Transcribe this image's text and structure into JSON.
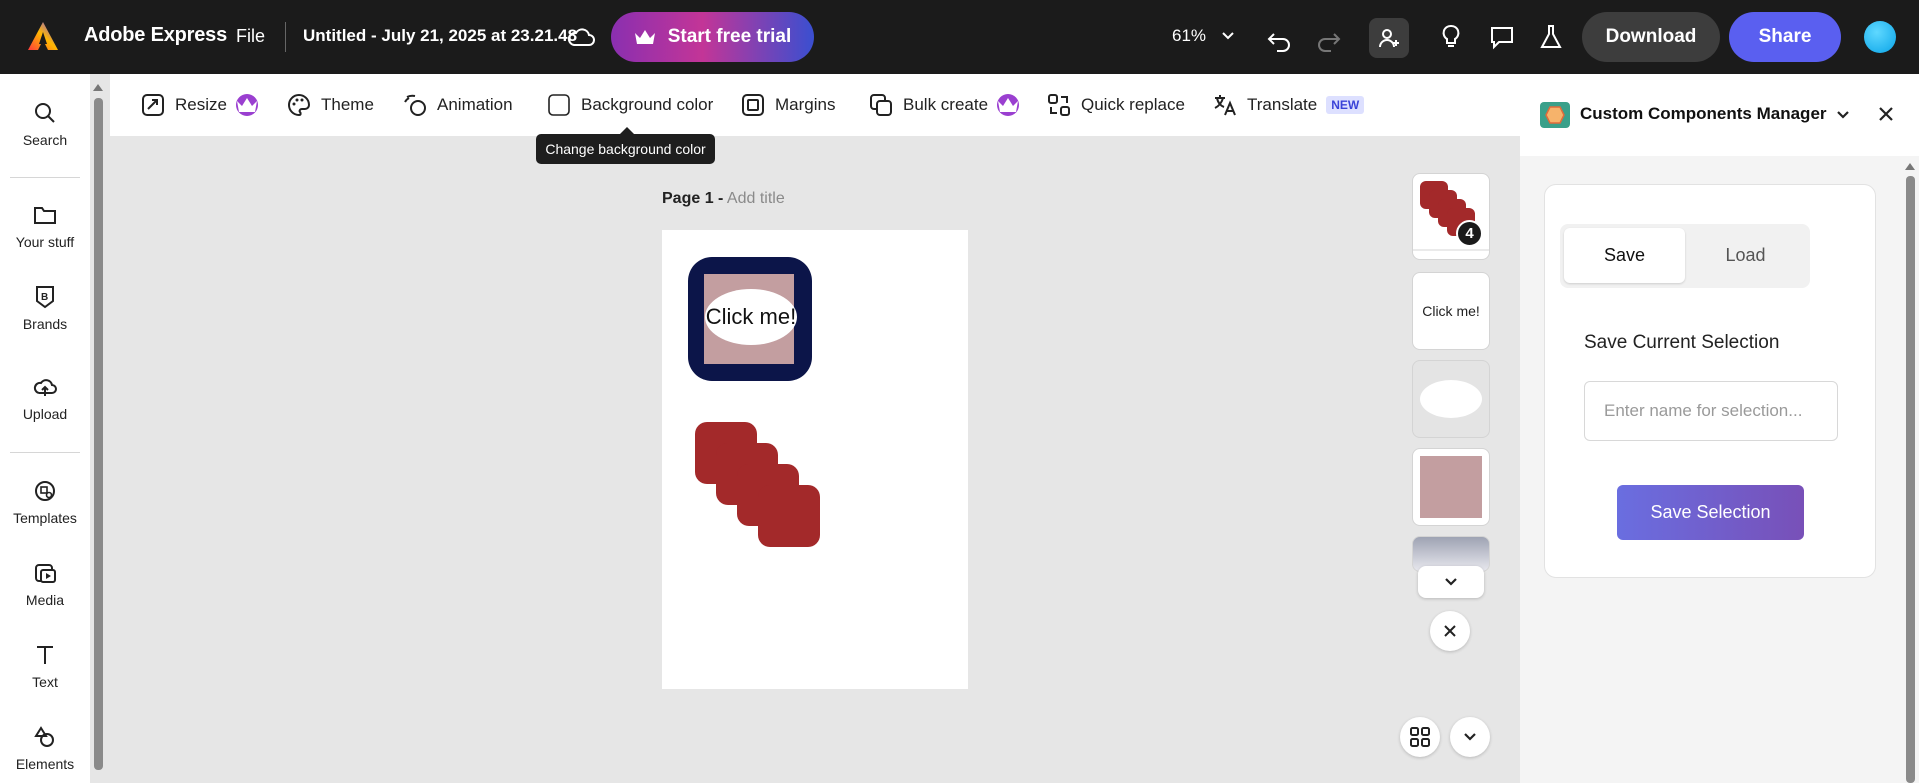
{
  "topbar": {
    "app_name": "Adobe Express",
    "file_menu": "File",
    "doc_title": "Untitled - July 21, 2025 at 23.21.48",
    "trial_button": "Start free trial",
    "zoom": "61%",
    "download_button": "Download",
    "share_button": "Share"
  },
  "leftrail": {
    "items": [
      {
        "label": "Search",
        "icon": "search-icon"
      },
      {
        "label": "Your stuff",
        "icon": "folder-icon"
      },
      {
        "label": "Brands",
        "icon": "brand-icon"
      },
      {
        "label": "Upload",
        "icon": "upload-cloud-icon"
      },
      {
        "label": "Templates",
        "icon": "templates-icon"
      },
      {
        "label": "Media",
        "icon": "media-icon"
      },
      {
        "label": "Text",
        "icon": "text-icon"
      },
      {
        "label": "Elements",
        "icon": "elements-icon"
      }
    ]
  },
  "toolbar": {
    "resize": "Resize",
    "theme": "Theme",
    "animation": "Animation",
    "background_color": "Background color",
    "margins": "Margins",
    "bulk_create": "Bulk create",
    "quick_replace": "Quick replace",
    "translate": "Translate",
    "new_badge": "NEW",
    "tooltip": "Change background color"
  },
  "canvas": {
    "page_label": "Page 1 -",
    "page_title_placeholder": "Add title",
    "button_text": "Click me!"
  },
  "layers": {
    "group_count": "4",
    "thumb_text": "Click me!"
  },
  "panel": {
    "title": "Custom Components Manager",
    "tab_save": "Save",
    "tab_load": "Load",
    "section_title": "Save Current Selection",
    "input_placeholder": "Enter name for selection...",
    "input_value": "",
    "save_button": "Save Selection"
  },
  "colors": {
    "accent": "#5a5ff0",
    "button_bg": "#0c1549",
    "square_fill": "#c39ea0",
    "red_shape": "#a3292a"
  }
}
